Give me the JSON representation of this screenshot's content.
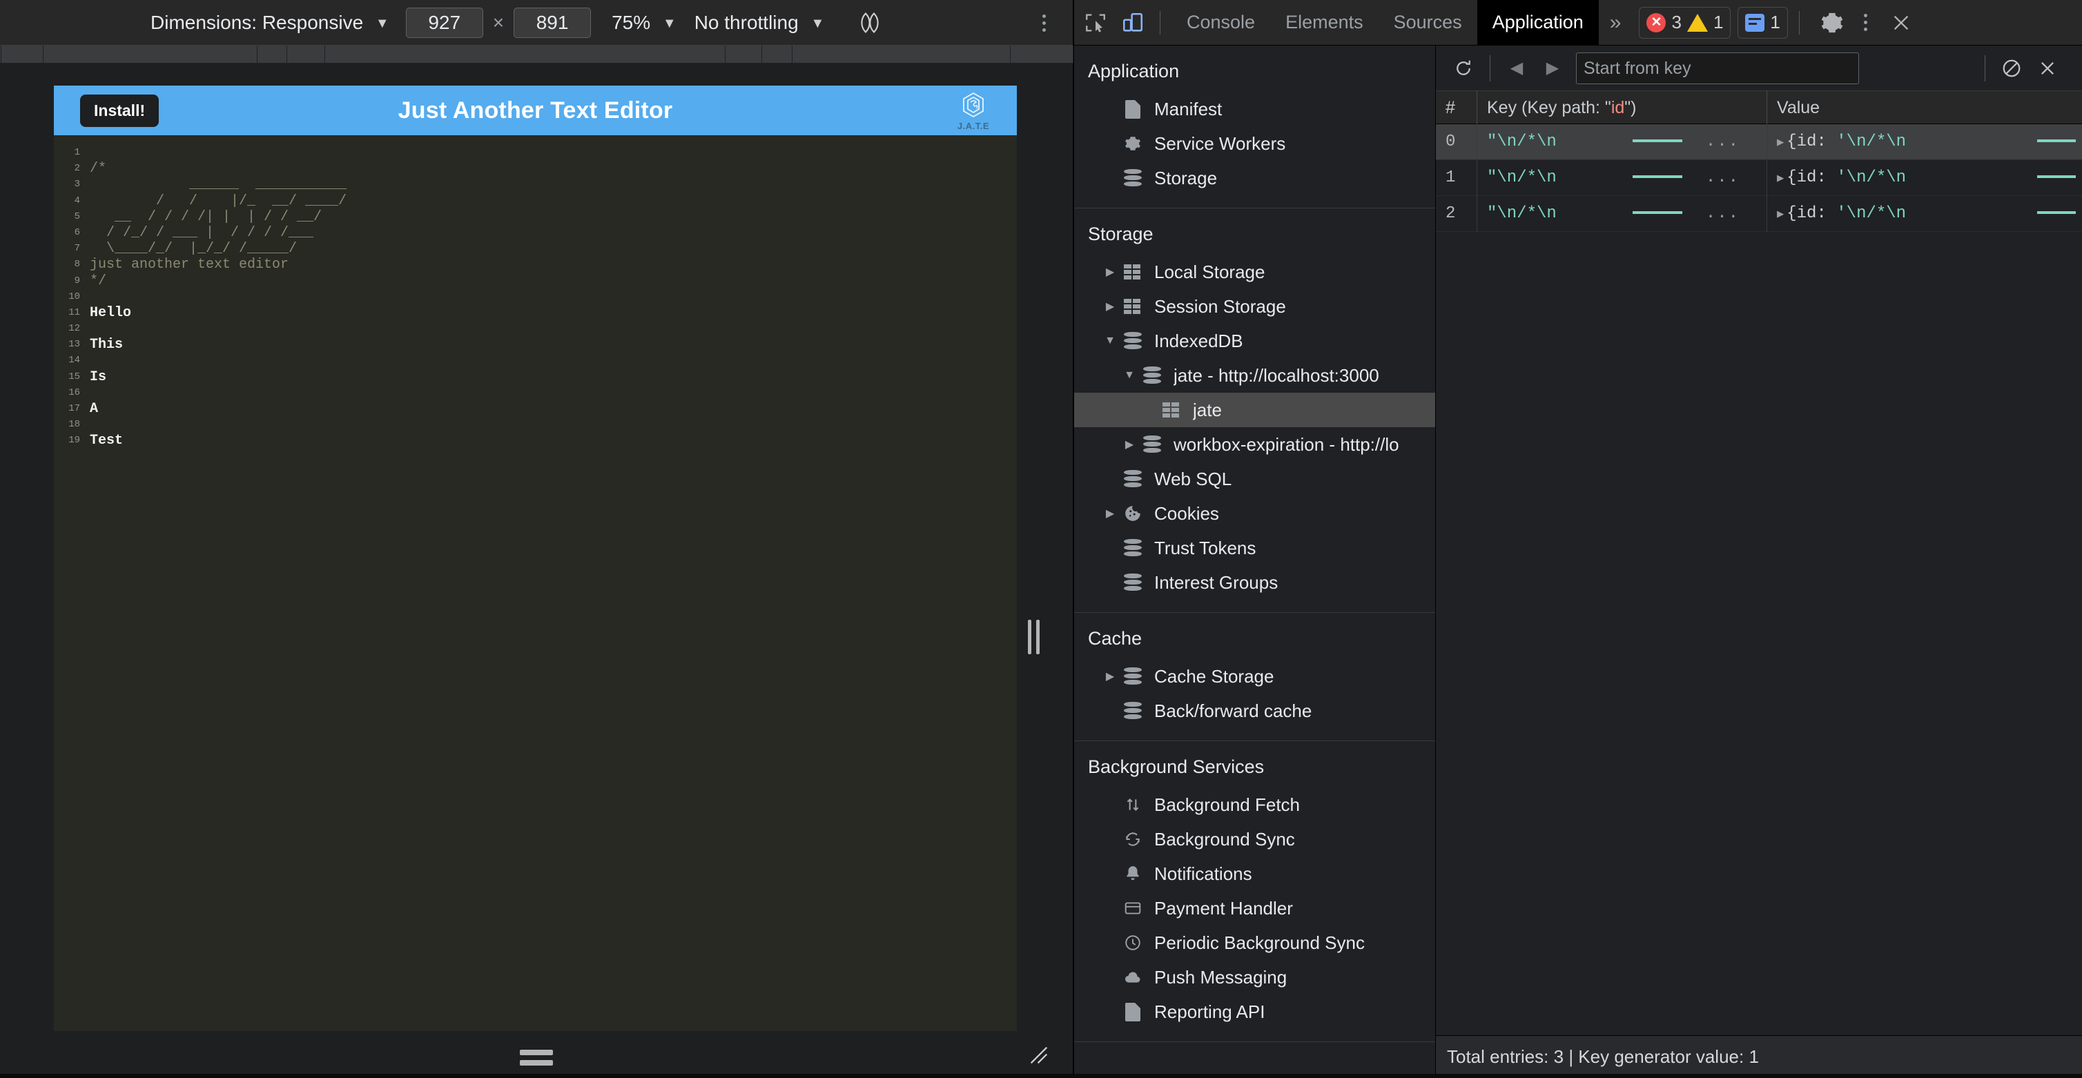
{
  "device_toolbar": {
    "dimensions_label": "Dimensions: Responsive",
    "width_value": "927",
    "x_sep": "×",
    "height_value": "891",
    "zoom_label": "75%",
    "throttling_label": "No throttling",
    "caret": "▼",
    "rotate_icon": "rotate-device-icon",
    "more_icon": "more-options-icon"
  },
  "app": {
    "install_button": "Install!",
    "title": "Just Another Text Editor",
    "logo_label": "J.A.T.E",
    "editor_lines": [
      {
        "n": "1",
        "text": "",
        "comment": true
      },
      {
        "n": "2",
        "text": "/*",
        "comment": true
      },
      {
        "n": "3",
        "text": "            ______  ___________",
        "comment": true
      },
      {
        "n": "4",
        "text": "        /   /    |/_  __/ ____/",
        "comment": true
      },
      {
        "n": "5",
        "text": "   __  / / / /| |  | / / __/",
        "comment": true
      },
      {
        "n": "6",
        "text": "  / /_/ / ___ |  / / / /___",
        "comment": true
      },
      {
        "n": "7",
        "text": "  \\____/_/  |_/_/ /_____/",
        "comment": true
      },
      {
        "n": "8",
        "text": "just another text editor",
        "comment": true
      },
      {
        "n": "9",
        "text": "*/",
        "comment": true
      },
      {
        "n": "10",
        "text": "",
        "comment": false
      },
      {
        "n": "11",
        "text": "Hello",
        "comment": false
      },
      {
        "n": "12",
        "text": "",
        "comment": false
      },
      {
        "n": "13",
        "text": "This",
        "comment": false
      },
      {
        "n": "14",
        "text": "",
        "comment": false
      },
      {
        "n": "15",
        "text": "Is",
        "comment": false
      },
      {
        "n": "16",
        "text": "",
        "comment": false
      },
      {
        "n": "17",
        "text": "A",
        "comment": false
      },
      {
        "n": "18",
        "text": "",
        "comment": false
      },
      {
        "n": "19",
        "text": "Test",
        "comment": false
      }
    ]
  },
  "devtools": {
    "inspect_icon": "inspect-element-icon",
    "device_toggle_icon": "toggle-device-toolbar-icon",
    "tabs": [
      {
        "label": "Console",
        "active": false
      },
      {
        "label": "Elements",
        "active": false
      },
      {
        "label": "Sources",
        "active": false
      },
      {
        "label": "Application",
        "active": true
      }
    ],
    "more_tabs_icon": "»",
    "error_count": "3",
    "warning_count": "1",
    "message_count": "1",
    "settings_icon": "gear-icon",
    "menu_icon": "more-options-icon",
    "close_icon": "close-icon"
  },
  "sidebar": {
    "sections": [
      {
        "heading": "Application",
        "items": [
          {
            "label": "Manifest",
            "icon": "document-icon",
            "indent": 1,
            "arrow": "",
            "selected": false
          },
          {
            "label": "Service Workers",
            "icon": "gear-icon",
            "indent": 1,
            "arrow": "",
            "selected": false
          },
          {
            "label": "Storage",
            "icon": "database-icon",
            "indent": 1,
            "arrow": "",
            "selected": false
          }
        ]
      },
      {
        "heading": "Storage",
        "items": [
          {
            "label": "Local Storage",
            "icon": "table-icon",
            "indent": 1,
            "arrow": "▶",
            "selected": false
          },
          {
            "label": "Session Storage",
            "icon": "table-icon",
            "indent": 1,
            "arrow": "▶",
            "selected": false
          },
          {
            "label": "IndexedDB",
            "icon": "database-icon",
            "indent": 1,
            "arrow": "▼",
            "selected": false
          },
          {
            "label": "jate - http://localhost:3000",
            "icon": "database-icon",
            "indent": 2,
            "arrow": "▼",
            "selected": false
          },
          {
            "label": "jate",
            "icon": "table-icon",
            "indent": 3,
            "arrow": "",
            "selected": true
          },
          {
            "label": "workbox-expiration - http://lo",
            "icon": "database-icon",
            "indent": 2,
            "arrow": "▶",
            "selected": false
          },
          {
            "label": "Web SQL",
            "icon": "database-icon",
            "indent": 1,
            "arrow": "",
            "selected": false
          },
          {
            "label": "Cookies",
            "icon": "cookie-icon",
            "indent": 1,
            "arrow": "▶",
            "selected": false
          },
          {
            "label": "Trust Tokens",
            "icon": "database-icon",
            "indent": 1,
            "arrow": "",
            "selected": false
          },
          {
            "label": "Interest Groups",
            "icon": "database-icon",
            "indent": 1,
            "arrow": "",
            "selected": false
          }
        ]
      },
      {
        "heading": "Cache",
        "items": [
          {
            "label": "Cache Storage",
            "icon": "database-icon",
            "indent": 1,
            "arrow": "▶",
            "selected": false
          },
          {
            "label": "Back/forward cache",
            "icon": "database-icon",
            "indent": 1,
            "arrow": "",
            "selected": false
          }
        ]
      },
      {
        "heading": "Background Services",
        "items": [
          {
            "label": "Background Fetch",
            "icon": "updown-arrows-icon",
            "indent": 1,
            "arrow": "",
            "selected": false
          },
          {
            "label": "Background Sync",
            "icon": "sync-icon",
            "indent": 1,
            "arrow": "",
            "selected": false
          },
          {
            "label": "Notifications",
            "icon": "bell-icon",
            "indent": 1,
            "arrow": "",
            "selected": false
          },
          {
            "label": "Payment Handler",
            "icon": "credit-card-icon",
            "indent": 1,
            "arrow": "",
            "selected": false
          },
          {
            "label": "Periodic Background Sync",
            "icon": "clock-icon",
            "indent": 1,
            "arrow": "",
            "selected": false
          },
          {
            "label": "Push Messaging",
            "icon": "cloud-icon",
            "indent": 1,
            "arrow": "",
            "selected": false
          },
          {
            "label": "Reporting API",
            "icon": "document-icon",
            "indent": 1,
            "arrow": "",
            "selected": false
          }
        ]
      }
    ]
  },
  "idb_panel": {
    "refresh_icon": "refresh-icon",
    "prev_icon": "◀",
    "next_icon": "▶",
    "start_from_key_placeholder": "Start from key",
    "clear_icon": "clear-object-store-icon",
    "delete_icon": "delete-selected-icon",
    "columns": {
      "index": "#",
      "key_prefix": "Key (Key path: \"",
      "key_path": "id",
      "key_suffix": "\")",
      "value": "Value"
    },
    "rows": [
      {
        "index": "0",
        "key": "\"\\n/*\\n",
        "value_prefix": "{id: ",
        "value": "'\\n/*\\n",
        "expand": "▶",
        "ellipsis": "…",
        "selected": true
      },
      {
        "index": "1",
        "key": "\"\\n/*\\n",
        "value_prefix": "{id: ",
        "value": "'\\n/*\\n",
        "expand": "▶",
        "ellipsis": "…",
        "selected": false
      },
      {
        "index": "2",
        "key": "\"\\n/*\\n",
        "value_prefix": "{id: ",
        "value": "'\\n/*\\n",
        "expand": "▶",
        "ellipsis": "…",
        "selected": false
      }
    ],
    "status": "Total entries: 3 | Key generator value: 1"
  },
  "colors": {
    "accent_blue": "#55acee",
    "string_green": "#7fd6c1",
    "keypath_red": "#f28b82",
    "selected_row": "#3f4041",
    "panel_bg": "#202124"
  }
}
